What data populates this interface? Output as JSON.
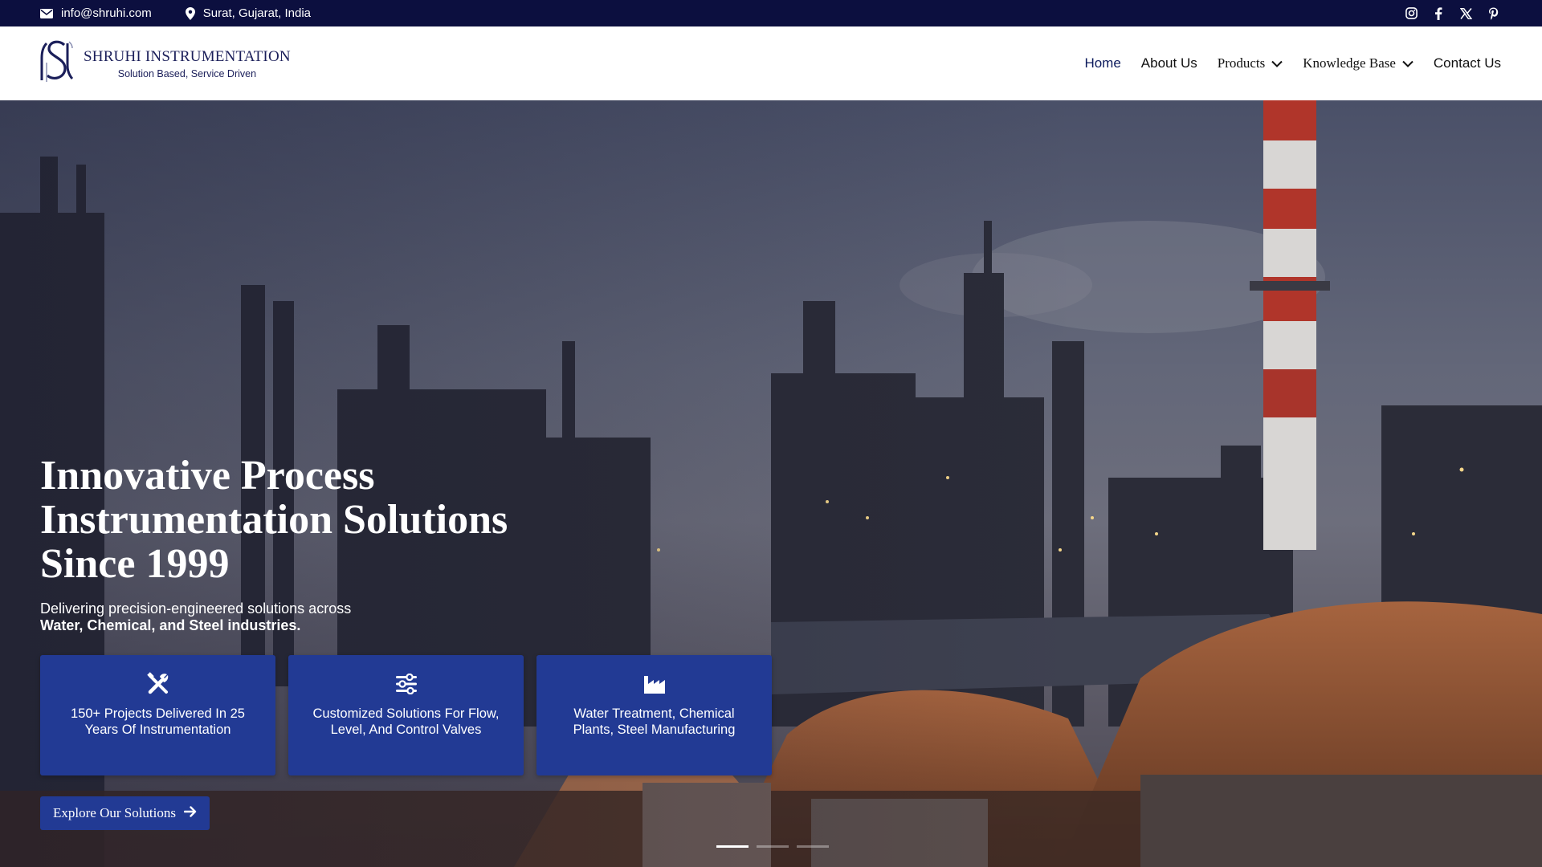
{
  "topbar": {
    "email": "info@shruhi.com",
    "location": "Surat, Gujarat, India",
    "email_icon": "envelope-icon",
    "location_icon": "map-pin-icon",
    "social": [
      "instagram-icon",
      "facebook-icon",
      "x-twitter-icon",
      "pinterest-icon"
    ]
  },
  "brand": {
    "name": "SHRUHI INSTRUMENTATION",
    "tagline": "Solution Based, Service Driven"
  },
  "nav": {
    "home": "Home",
    "about": "About Us",
    "products": "Products",
    "knowledge": "Knowledge Base",
    "contact": "Contact Us"
  },
  "hero": {
    "title_line1": "Innovative Process",
    "title_line2": "Instrumentation Solutions",
    "title_line3": "Since 1999",
    "subtitle_line1": "Delivering precision-engineered solutions across",
    "subtitle_line2": "Water, Chemical, and Steel industries.",
    "cards": [
      {
        "icon": "tools-icon",
        "text": "150+ Projects Delivered In 25 Years Of Instrumentation"
      },
      {
        "icon": "sliders-icon",
        "text": "Customized Solutions For Flow, Level, And Control Valves"
      },
      {
        "icon": "industry-icon",
        "text": "Water Treatment, Chemical Plants, Steel Manufacturing"
      }
    ],
    "cta_label": "Explore Our Solutions",
    "slides_count": 3,
    "active_slide": 1
  },
  "colors": {
    "topbar_bg": "#0c0f3f",
    "brand_navy": "#1b1f5a",
    "card_blue": "#223a94",
    "text_white": "#ffffff"
  }
}
